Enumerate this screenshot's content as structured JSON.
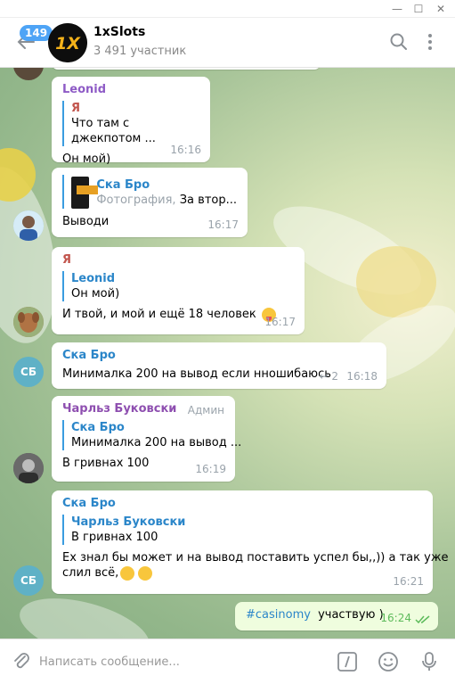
{
  "window": {
    "minimize": "—",
    "maximize": "☐",
    "close": "✕"
  },
  "header": {
    "unread_badge": "149",
    "channel_title": "1xSlots",
    "channel_avatar_text": "1X",
    "member_count": "3 491 участник"
  },
  "messages": [
    {
      "sender": "Leonid",
      "reply_name": "Я",
      "reply_text": "Что там с джекпотом ...",
      "text": "Он мой)",
      "time": "16:16"
    },
    {
      "reply_name": "Ска Бро",
      "reply_kind": "Фотография,",
      "reply_text": "За втор...",
      "text": "Выводи",
      "time": "16:17"
    },
    {
      "sender": "Я",
      "reply_name": "Leonid",
      "reply_text": "Он мой)",
      "text": "И твой, и мой и ещё 18 человек",
      "time": "16:17"
    },
    {
      "sender": "Ска Бро",
      "avatar_initials": "СБ",
      "text": "Минималка 200 на вывод если нношибаюсь",
      "reply_count": "2",
      "time": "16:18"
    },
    {
      "sender": "Чарльз Буковски",
      "role": "Админ",
      "reply_name": "Ска Бро",
      "reply_text": "Минималка 200 на вывод ...",
      "text": "В гривнах 100",
      "time": "16:19"
    },
    {
      "sender": "Ска Бро",
      "avatar_initials": "СБ",
      "reply_name": "Чарльз Буковски",
      "reply_text": "В гривнах 100",
      "text_line1": "Ех знал бы может и на вывод поставить успел бы,,)) а так уже",
      "text_line2": "слил всё,",
      "time": "16:21"
    },
    {
      "hashtag": "#casinomy",
      "text": "участвую )",
      "time": "16:24",
      "outgoing": true
    }
  ],
  "composer": {
    "placeholder": "Написать сообщение..."
  },
  "colors": {
    "accent": "#4ea4f6",
    "leonid": "#8e5bc6",
    "me": "#c2554d",
    "skabro": "#2b86c9",
    "charles": "#8e4fb0",
    "outgoing_bg": "#effdde",
    "read_check": "#5dbb5b"
  }
}
